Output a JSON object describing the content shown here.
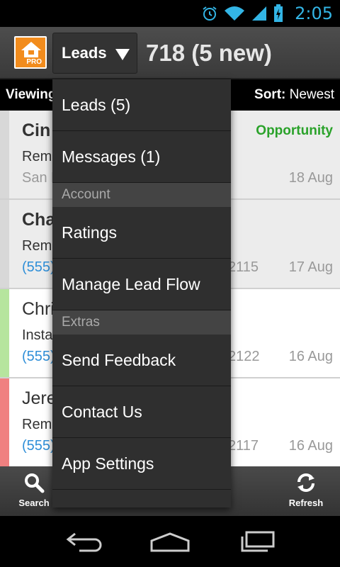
{
  "status_bar": {
    "time": "2:05"
  },
  "action_bar": {
    "logo_badge": "PRO",
    "spinner_label": "Leads",
    "count_text": "718 (5 new)"
  },
  "view_bar": {
    "viewing_label": "Viewing",
    "sort_label": "Sort:",
    "sort_value": "Newest"
  },
  "leads": [
    {
      "name": "Cin",
      "tag": "Opportunity",
      "desc": "Remo",
      "city": "San F",
      "ext": "",
      "date": "18 Aug",
      "stripe": "#d8d8d8",
      "bg": "#ececec"
    },
    {
      "name": "Cha",
      "tag": "",
      "desc": "Remo",
      "phone": "(555)",
      "ext": "2115",
      "date": "17 Aug",
      "stripe": "#d8d8d8",
      "bg": "#ececec"
    },
    {
      "name": "Chri",
      "tag": "",
      "desc": "Insta",
      "phone": "(555)",
      "ext": "2122",
      "date": "16 Aug",
      "stripe": "#b6e59e",
      "bg": "#ffffff"
    },
    {
      "name": "Jere",
      "tag": "",
      "desc": "Remo",
      "phone": "(555)",
      "ext": "2117",
      "date": "16 Aug",
      "stripe": "#f08080",
      "bg": "#ffffff"
    }
  ],
  "menu": {
    "items": [
      {
        "kind": "item",
        "label": "Leads (5)"
      },
      {
        "kind": "item",
        "label": "Messages (1)"
      },
      {
        "kind": "header",
        "label": "Account"
      },
      {
        "kind": "item",
        "label": "Ratings"
      },
      {
        "kind": "item",
        "label": "Manage Lead Flow"
      },
      {
        "kind": "header",
        "label": "Extras"
      },
      {
        "kind": "item",
        "label": "Send Feedback"
      },
      {
        "kind": "item",
        "label": "Contact Us"
      },
      {
        "kind": "item",
        "label": "App Settings"
      }
    ]
  },
  "bottom_bar": {
    "search_label": "Search",
    "refresh_label": "Refresh"
  },
  "colors": {
    "accent": "#33b5e5",
    "logo": "#f28c1d",
    "opportunity": "#2aa22a",
    "phone_link": "#2f8fd8"
  }
}
